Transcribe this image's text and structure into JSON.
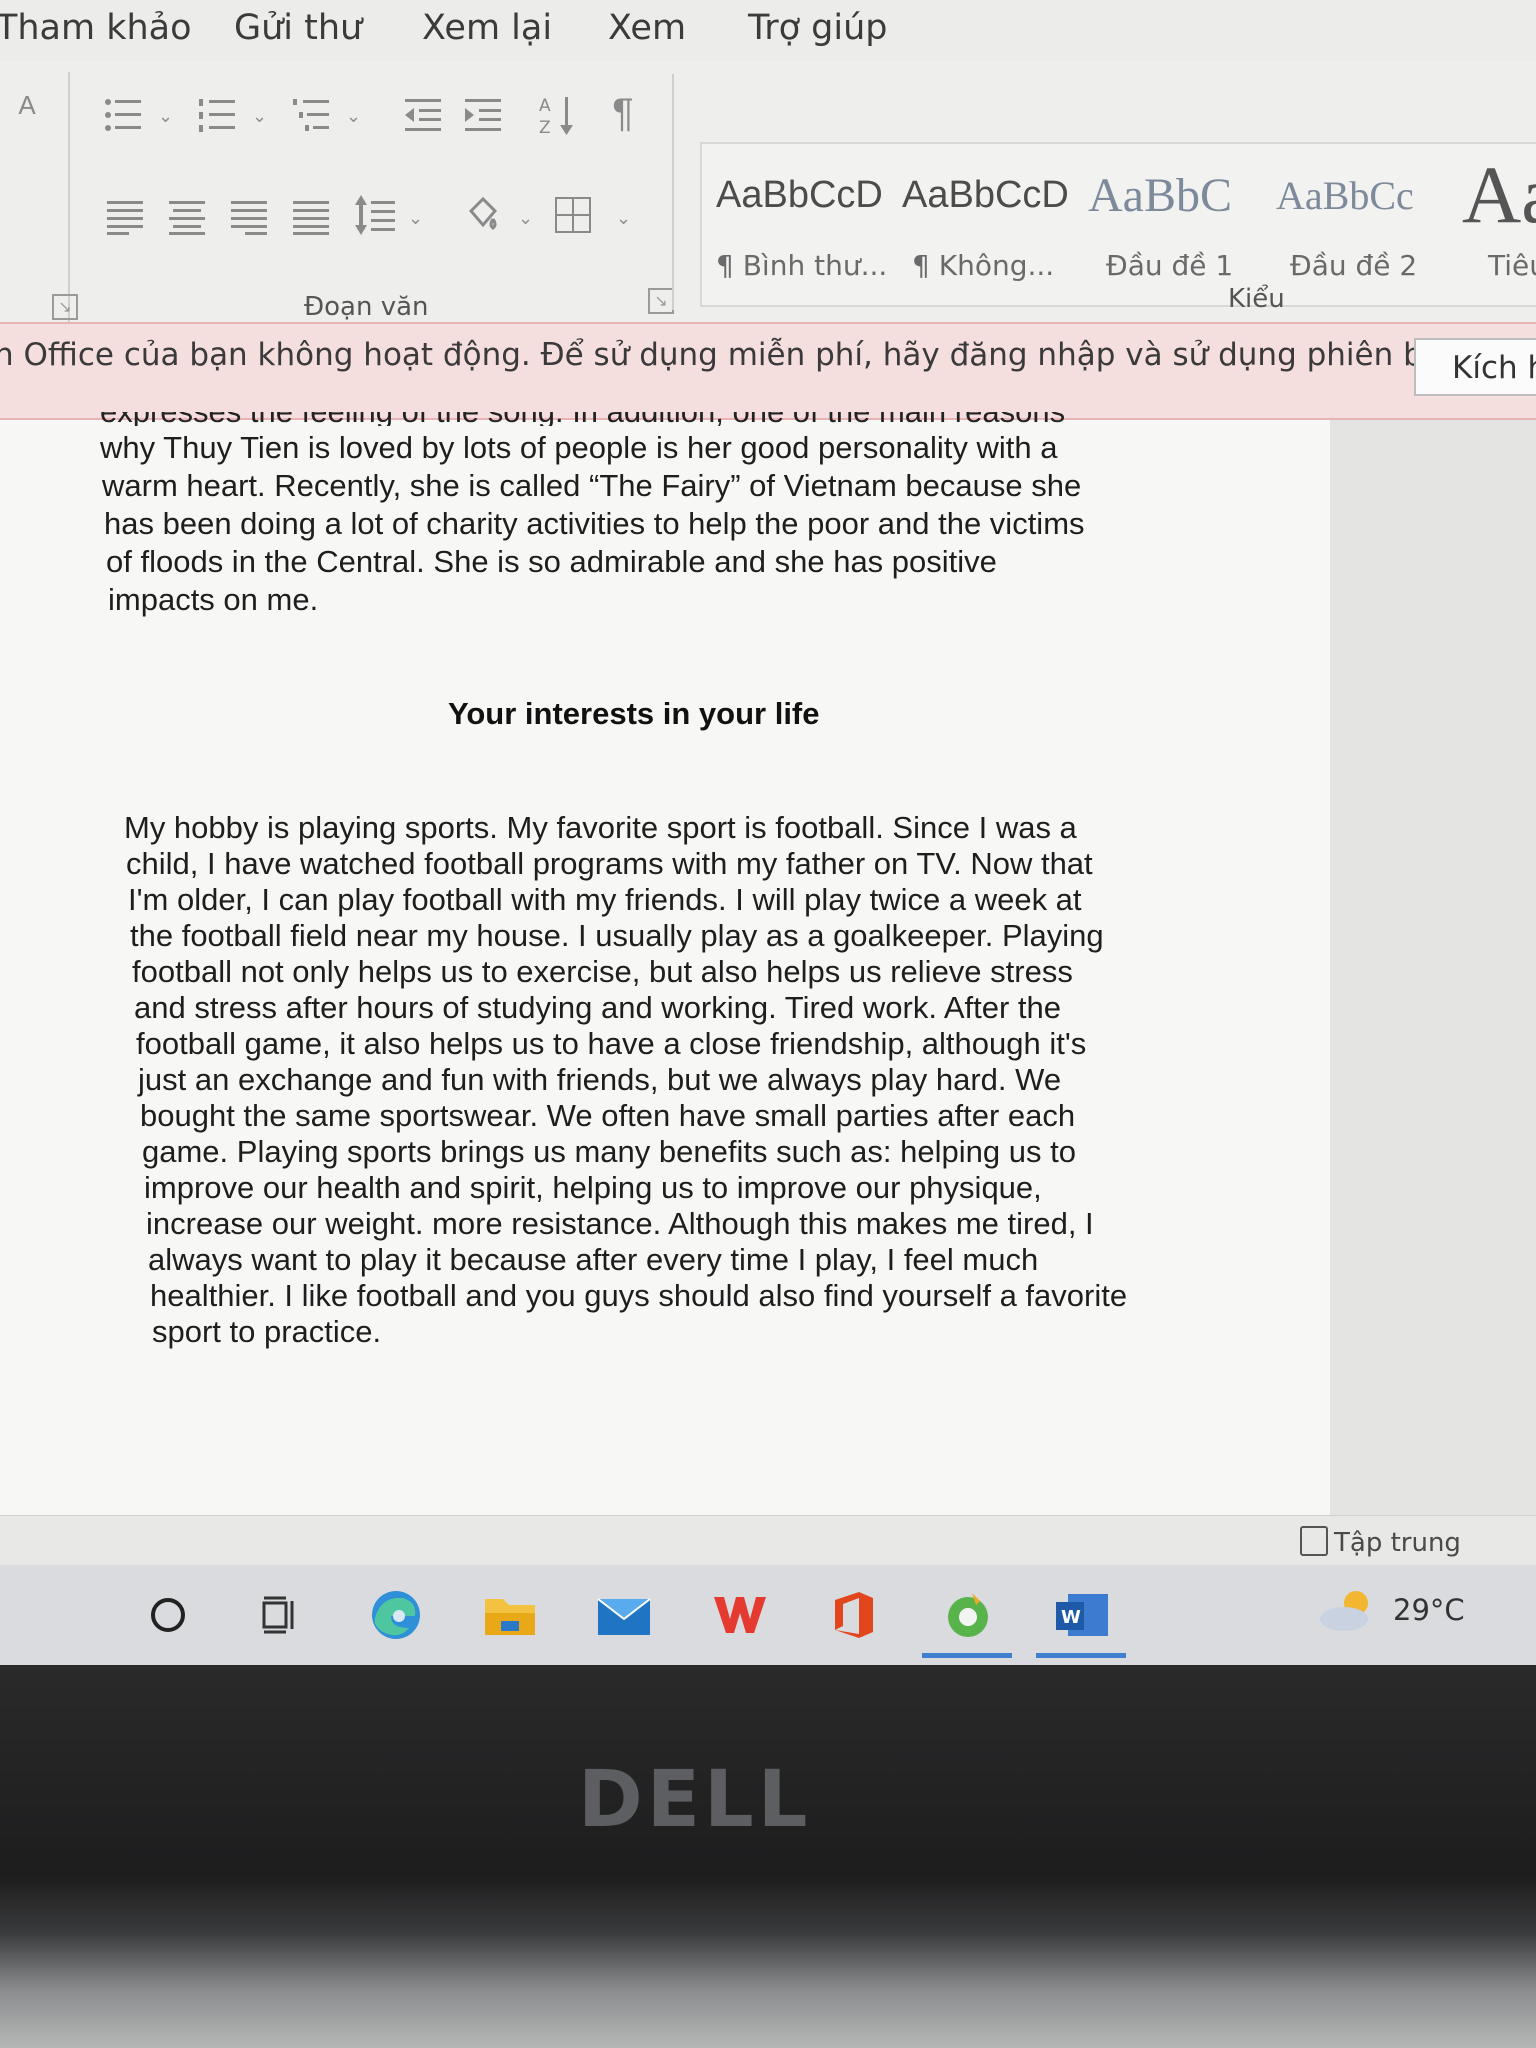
{
  "menu": {
    "tabs": [
      "Tham khảo",
      "Gửi thư",
      "Xem lại",
      "Xem",
      "Trợ giúp"
    ]
  },
  "ribbon": {
    "paragraph_group_label": "Đoạn văn",
    "styles_group_label": "Kiểu",
    "styles": [
      {
        "preview": "AaBbCcD",
        "name": "¶ Bình thư..."
      },
      {
        "preview": "AaBbCcD",
        "name": "¶ Không..."
      },
      {
        "preview": "AaBbC",
        "name": "Đầu đề 1"
      },
      {
        "preview": "AaBbCc",
        "name": "Đầu đề 2"
      },
      {
        "preview": "Aa",
        "name": "Tiêu"
      }
    ],
    "icons": [
      "bullets-icon",
      "numbering-icon",
      "multilevel-list-icon",
      "decrease-indent-icon",
      "increase-indent-icon",
      "sort-icon",
      "pilcrow-icon",
      "align-left-icon",
      "align-center-icon",
      "align-right-icon",
      "justify-icon",
      "line-spacing-icon",
      "shading-icon",
      "borders-icon"
    ]
  },
  "banner": {
    "message": "n Office của bạn không hoạt động. Để sử dụng miễn phí, hãy đăng nhập và sử dụng phiên bản trên",
    "button_label": "Kích h"
  },
  "document": {
    "cut_line": "expresses the feeling of the song. In addition, one of the main reasons",
    "paragraph1": [
      "why Thuy Tien is loved by lots of people is her good personality with a",
      "warm heart. Recently, she is called “The Fairy” of Vietnam because she",
      "has been doing a lot of charity activities to help the poor and the victims",
      "of floods in the Central. She is so admirable and she has positive",
      "impacts on me."
    ],
    "heading": "Your interests in your life",
    "paragraph2": [
      "My hobby is playing sports. My favorite sport is football. Since I was a",
      "child, I have watched football programs with my father on TV. Now that",
      "I'm older, I can play football with my friends. I will play twice a week at",
      "the football field near my house. I usually play as a goalkeeper. Playing",
      "football not only helps us to exercise, but also helps us relieve stress",
      "and stress after hours of studying and working. Tired work. After the",
      "football game, it also helps us to have a close friendship, although it's",
      "just an exchange and fun with friends, but we always play hard. We",
      "bought the same sportswear. We often have small parties after each",
      "game. Playing sports brings us many benefits such as: helping us to",
      "improve our health and spirit, helping us to improve our physique,",
      "increase our weight. more resistance. Although this makes me tired, I",
      "always want to play it because after every time I play, I feel much",
      "healthier. I like football and you guys should also find yourself a favorite",
      "sport to practice."
    ]
  },
  "status_bar": {
    "focus_label": "Tập trung"
  },
  "taskbar": {
    "apps": [
      "search-icon",
      "task-view-icon",
      "edge-icon",
      "file-explorer-icon",
      "mail-icon",
      "wps-icon",
      "office-icon",
      "coccoc-icon",
      "word-icon"
    ],
    "temperature": "29°C"
  },
  "bezel": {
    "brand": "DELL"
  },
  "colors": {
    "banner_bg": "#f5dede",
    "word_blue": "#2b5797",
    "page_bg": "#f7f7f5"
  }
}
